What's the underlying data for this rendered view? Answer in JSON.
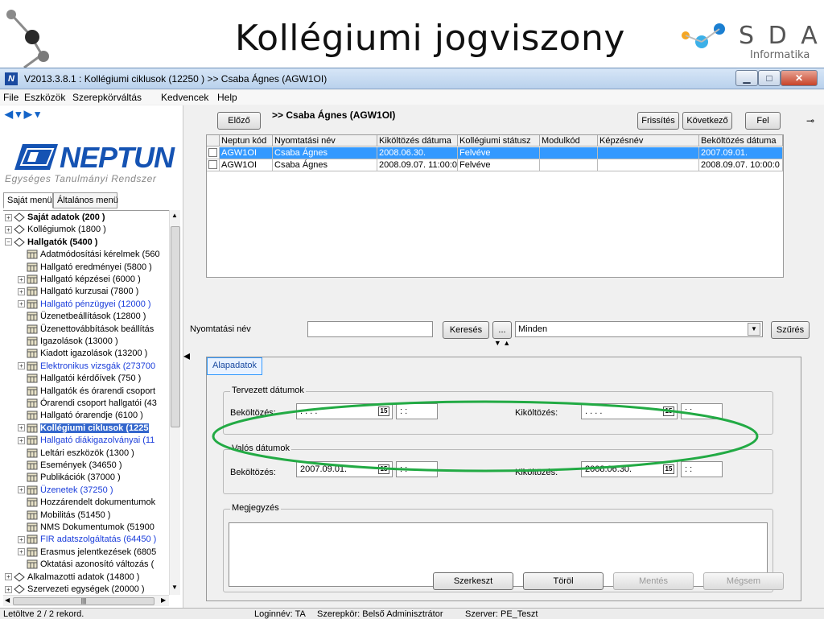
{
  "slide": {
    "title": "Kollégiumi jogviszony",
    "logo": {
      "letters": "S D A",
      "subtitle": "Informatika"
    }
  },
  "window": {
    "title": "V2013.3.8.1 : Kollégiumi ciklusok (12250 ) >> Csaba Ágnes (AGW1OI)",
    "icon_letter": "N"
  },
  "menu": [
    "File",
    "Eszközök",
    "Szerepkörváltás",
    "Kedvencek",
    "Help"
  ],
  "left": {
    "brand": "NEPTUN",
    "brand_sub": "Egységes Tanulmányi Rendszer",
    "tabs": [
      "Saját menü",
      "Általános menü"
    ],
    "tree": [
      {
        "label": "Saját adatok (200 )",
        "style": "bold",
        "exp": "+",
        "level": 0
      },
      {
        "label": "Kollégiumok (1800 )",
        "style": "",
        "exp": "+",
        "level": 0
      },
      {
        "label": "Hallgatók (5400 )",
        "style": "bold",
        "exp": "−",
        "level": 0
      },
      {
        "label": "Adatmódosítási kérelmek (560",
        "style": "",
        "exp": "",
        "level": 1
      },
      {
        "label": "Hallgató eredményei (5800 )",
        "style": "",
        "exp": "",
        "level": 1
      },
      {
        "label": "Hallgató képzései (6000 )",
        "style": "",
        "exp": "+",
        "level": 1
      },
      {
        "label": "Hallgató kurzusai (7800 )",
        "style": "",
        "exp": "+",
        "level": 1
      },
      {
        "label": "Hallgató pénzügyei (12000 )",
        "style": "blue",
        "exp": "+",
        "level": 1
      },
      {
        "label": "Üzenetbeállítások (12800 )",
        "style": "",
        "exp": "",
        "level": 1
      },
      {
        "label": "Üzenettovábbítások beállítás",
        "style": "",
        "exp": "",
        "level": 1
      },
      {
        "label": "Igazolások (13000 )",
        "style": "",
        "exp": "",
        "level": 1
      },
      {
        "label": "Kiadott igazolások (13200 )",
        "style": "",
        "exp": "",
        "level": 1
      },
      {
        "label": "Elektronikus vizsgák (273700",
        "style": "blue",
        "exp": "+",
        "level": 1
      },
      {
        "label": "Hallgatói kérdőívek (750 )",
        "style": "",
        "exp": "",
        "level": 1
      },
      {
        "label": "Hallgatók és órarendi csoport",
        "style": "",
        "exp": "",
        "level": 1
      },
      {
        "label": "Órarendi csoport hallgatói (43",
        "style": "",
        "exp": "",
        "level": 1
      },
      {
        "label": "Hallgató órarendje (6100 )",
        "style": "",
        "exp": "",
        "level": 1
      },
      {
        "label": "Kollégiumi ciklusok (1225",
        "style": "sel",
        "exp": "+",
        "level": 1
      },
      {
        "label": "Hallgató diákigazolványai (11",
        "style": "blue",
        "exp": "+",
        "level": 1
      },
      {
        "label": "Leltári eszközök (1300 )",
        "style": "",
        "exp": "",
        "level": 1
      },
      {
        "label": "Események (34650 )",
        "style": "",
        "exp": "",
        "level": 1
      },
      {
        "label": "Publikációk (37000 )",
        "style": "",
        "exp": "",
        "level": 1
      },
      {
        "label": "Üzenetek (37250 )",
        "style": "blue",
        "exp": "+",
        "level": 1
      },
      {
        "label": "Hozzárendelt dokumentumok",
        "style": "",
        "exp": "",
        "level": 1
      },
      {
        "label": "Mobilitás (51450 )",
        "style": "",
        "exp": "",
        "level": 1
      },
      {
        "label": "NMS Dokumentumok (51900",
        "style": "",
        "exp": "",
        "level": 1
      },
      {
        "label": "FIR adatszolgáltatás (64450 )",
        "style": "blue",
        "exp": "+",
        "level": 1
      },
      {
        "label": "Erasmus jelentkezések (6805",
        "style": "",
        "exp": "+",
        "level": 1
      },
      {
        "label": "Oktatási azonosító változás (",
        "style": "",
        "exp": "",
        "level": 1
      },
      {
        "label": "Alkalmazotti adatok (14800 )",
        "style": "",
        "exp": "+",
        "level": 0
      },
      {
        "label": "Szervezeti egységek (20000 )",
        "style": "",
        "exp": "+",
        "level": 0
      }
    ]
  },
  "toolbar": {
    "prev": "Előző",
    "record": ">> Csaba Ágnes (AGW1OI)",
    "refresh": "Frissítés",
    "next": "Következő",
    "up": "Fel"
  },
  "grid": {
    "columns": [
      "Neptun kód",
      "Nyomtatási név",
      "Kiköltözés dátuma",
      "Kollégiumi státusz",
      "Modulkód",
      "Képzésnév",
      "Beköltözés dátuma"
    ],
    "rows": [
      [
        "AGW1OI",
        "Csaba Ágnes",
        "2008.06.30.",
        "Felvéve",
        "",
        "",
        "2007.09.01."
      ],
      [
        "AGW1OI",
        "Csaba Ágnes",
        "2008.09.07. 11:00:0",
        "Felvéve",
        "",
        "",
        "2008.09.07. 10:00:0"
      ]
    ]
  },
  "filter": {
    "label": "Nyomtatási név",
    "search": "Keresés",
    "more": "...",
    "scope": "Minden",
    "apply": "Szűrés"
  },
  "detail": {
    "tab": "Alapadatok",
    "planned": {
      "title": "Tervezett dátumok",
      "in_label": "Beköltözés:",
      "in_date": ". . . .",
      "in_time": ": :",
      "out_label": "Kiköltözés:",
      "out_date": ". . . .",
      "out_time": ": :"
    },
    "actual": {
      "title": "Valós dátumok",
      "in_label": "Beköltözés:",
      "in_date": "2007.09.01.",
      "in_time": ": :",
      "out_label": "Kiköltözés:",
      "out_date": "2008.06.30.",
      "out_time": ": :"
    },
    "notes": "Megjegyzés",
    "cal": "15"
  },
  "actions": {
    "edit": "Szerkeszt",
    "delete": "Töröl",
    "save": "Mentés",
    "cancel": "Mégsem"
  },
  "status": {
    "records": "Letöltve 2 / 2 rekord.",
    "login": "Loginnév: TA",
    "role": "Szerepkör: Belső Adminisztrátor",
    "server": "Szerver: PE_Teszt"
  },
  "colors": {
    "selection": "#3399ff",
    "neptun_blue": "#1553b3",
    "highlight_ellipse": "#22aa44"
  }
}
